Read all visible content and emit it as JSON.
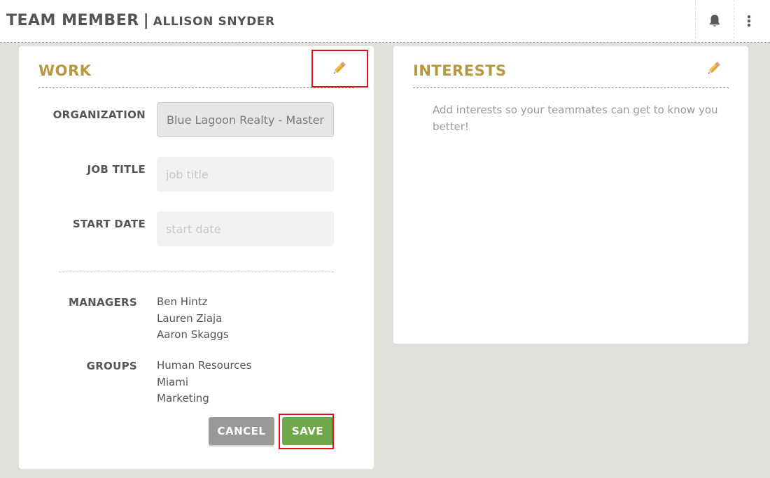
{
  "header": {
    "title": "TEAM MEMBER",
    "separator": "|",
    "member_name": "ALLISON SNYDER",
    "icons": [
      "bell-icon",
      "more-vertical-icon"
    ]
  },
  "work": {
    "title": "WORK",
    "edit_icon": "pencil-icon",
    "fields": {
      "organization": {
        "label": "ORGANIZATION",
        "value": "Blue Lagoon Realty - Master"
      },
      "job_title": {
        "label": "JOB TITLE",
        "value": "",
        "placeholder": "job title"
      },
      "start_date": {
        "label": "START DATE",
        "value": "",
        "placeholder": "start date"
      }
    },
    "managers": {
      "label": "MANAGERS",
      "items": [
        "Ben Hintz",
        "Lauren Ziaja",
        "Aaron Skaggs"
      ]
    },
    "groups": {
      "label": "GROUPS",
      "items": [
        "Human Resources",
        "Miami",
        "Marketing"
      ]
    },
    "buttons": {
      "cancel": "CANCEL",
      "save": "SAVE"
    }
  },
  "interests": {
    "title": "INTERESTS",
    "edit_icon": "pencil-icon",
    "empty_message": "Add interests so your teammates can get to know you better!"
  },
  "colors": {
    "accent": "#b6983e",
    "save": "#6fa84a",
    "cancel": "#999999",
    "highlight": "#e0101a",
    "background": "#e0e0da"
  }
}
